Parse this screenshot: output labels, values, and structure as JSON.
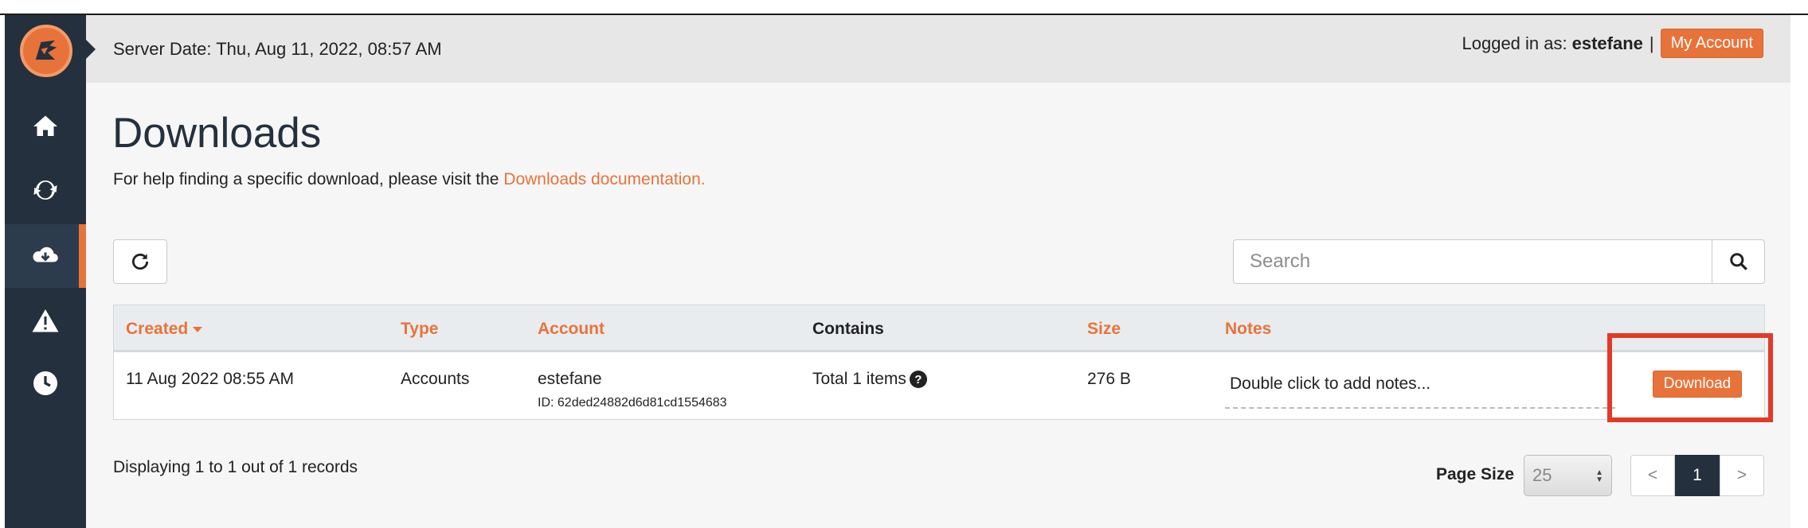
{
  "header": {
    "server_date": "Server Date: Thu, Aug 11, 2022, 08:57 AM",
    "logged_in_label": "Logged in as:",
    "username": "estefane",
    "separator": "|",
    "my_account_label": "My Account"
  },
  "sidebar": {
    "items": [
      {
        "icon": "home-icon"
      },
      {
        "icon": "sync-icon"
      },
      {
        "icon": "cloud-download-icon",
        "active": true
      },
      {
        "icon": "warning-icon"
      },
      {
        "icon": "clock-icon"
      }
    ]
  },
  "page": {
    "title": "Downloads",
    "help_prefix": "For help finding a specific download, please visit the ",
    "help_link": "Downloads documentation."
  },
  "toolbar": {
    "search_placeholder": "Search"
  },
  "table": {
    "columns": [
      "Created",
      "Type",
      "Account",
      "Contains",
      "Size",
      "Notes"
    ],
    "rows": [
      {
        "created": "11 Aug 2022 08:55 AM",
        "type": "Accounts",
        "account": "estefane",
        "account_id": "ID: 62ded24882d6d81cd1554683",
        "contains": "Total 1 items",
        "size": "276 B",
        "notes": "Double click to add notes...",
        "action": "Download"
      }
    ]
  },
  "footer": {
    "records": "Displaying 1 to 1 out of 1 records",
    "page_size_label": "Page Size",
    "page_size_value": "25",
    "prev": "<",
    "current_page": "1",
    "next": ">"
  },
  "colors": {
    "accent": "#e8733a",
    "sidebar": "#24303d",
    "highlight": "#e23a26"
  }
}
